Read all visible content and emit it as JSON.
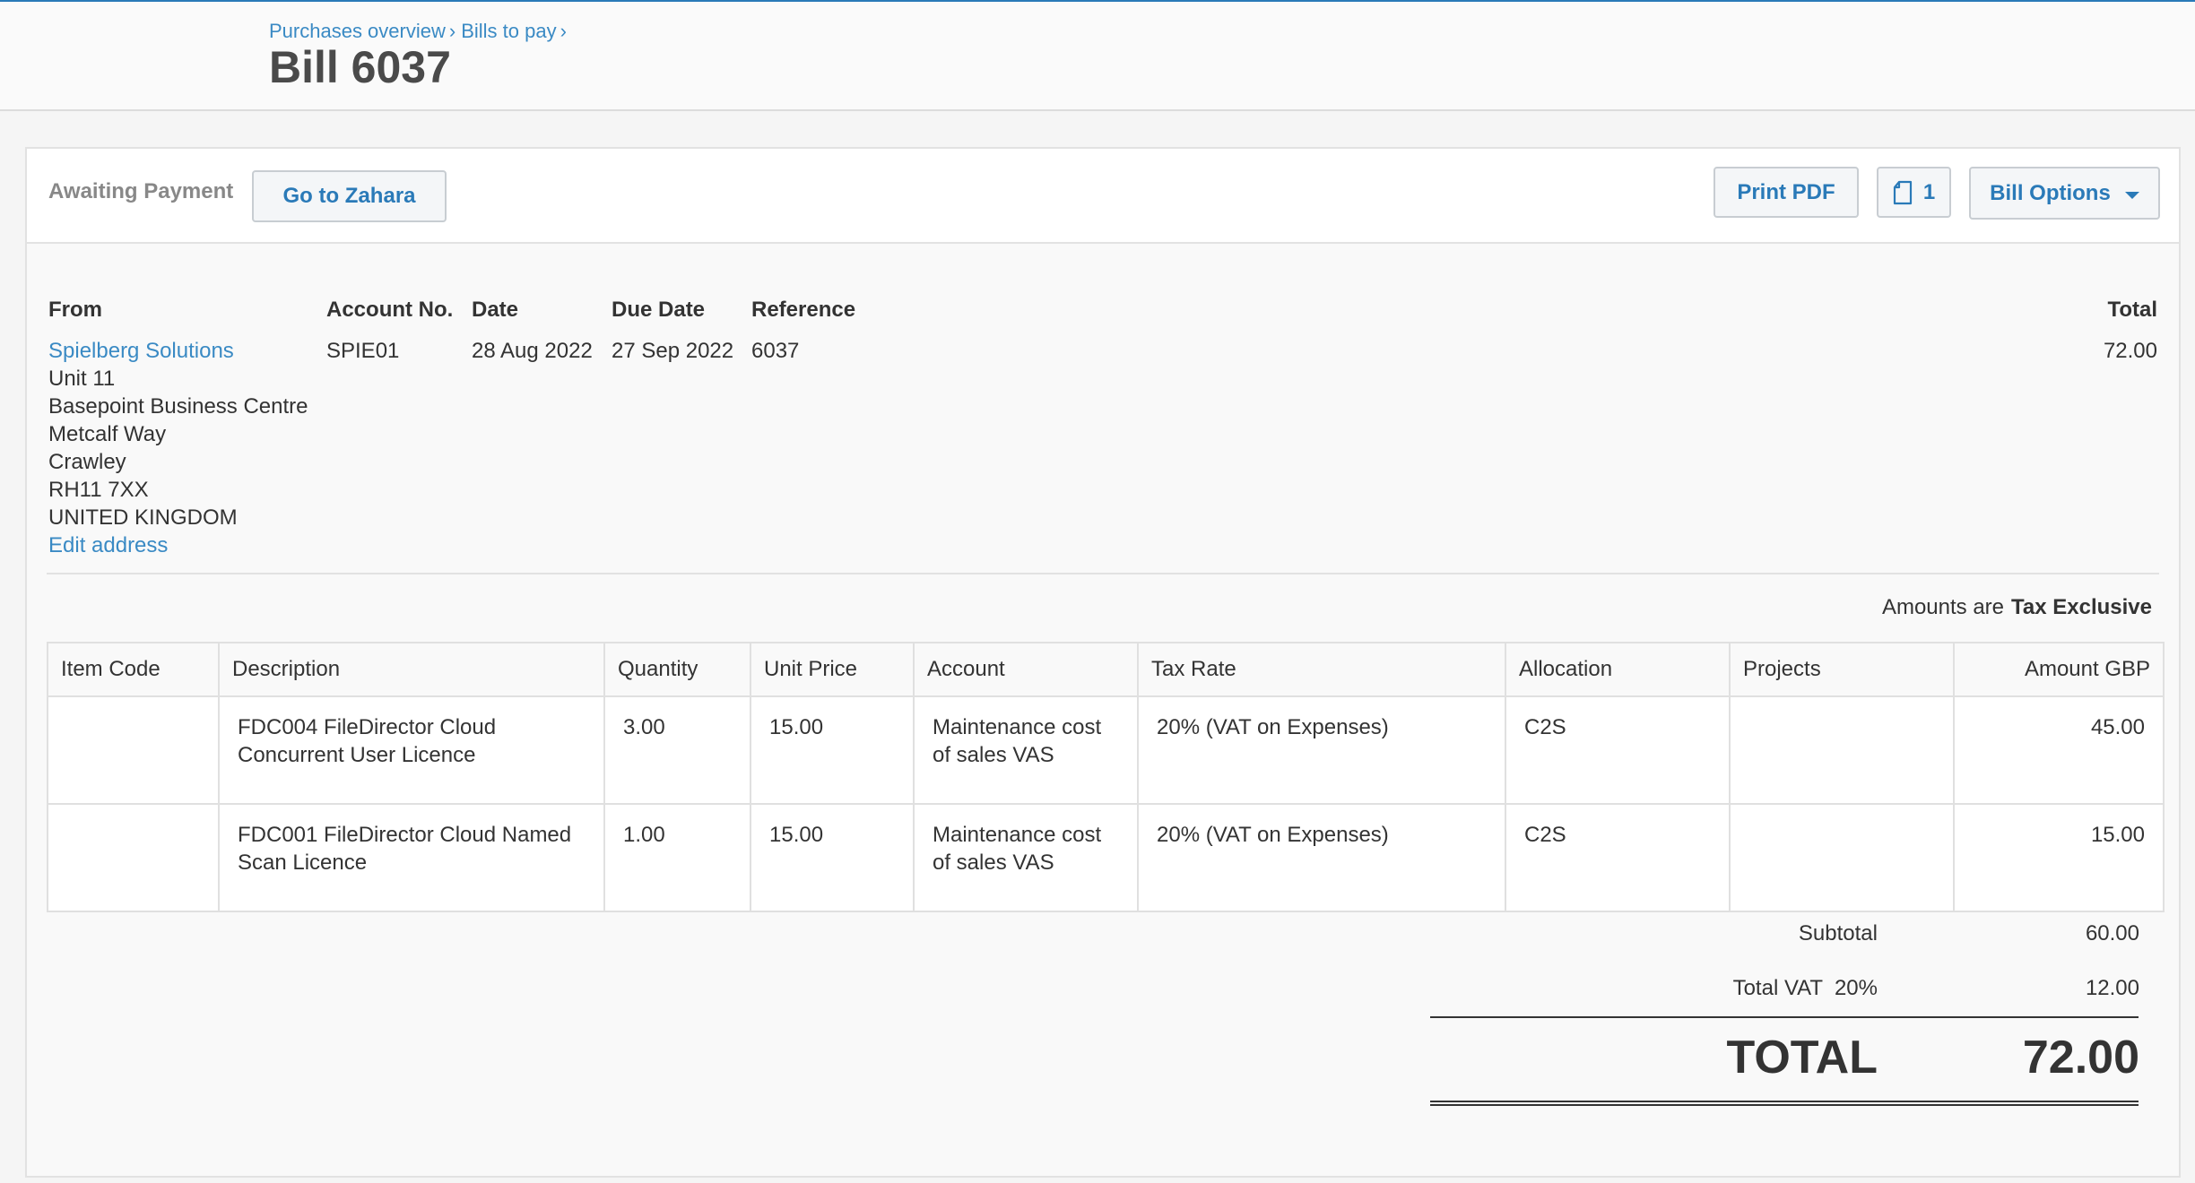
{
  "breadcrumb": [
    "Purchases overview",
    "Bills to pay"
  ],
  "page_title": "Bill 6037",
  "toolbar": {
    "status": "Awaiting Payment",
    "goto_label": "Go to Zahara",
    "print_label": "Print PDF",
    "attachment_count": "1",
    "options_label": "Bill Options"
  },
  "bill": {
    "labels": {
      "from": "From",
      "account_no": "Account No.",
      "date": "Date",
      "due_date": "Due Date",
      "reference": "Reference",
      "total": "Total"
    },
    "from_name": "Spielberg Solutions",
    "address": [
      "Unit 11",
      "Basepoint Business Centre",
      "Metcalf Way",
      "Crawley",
      "RH11 7XX",
      "UNITED KINGDOM"
    ],
    "edit_address": "Edit address",
    "account_no": "SPIE01",
    "date": "28 Aug 2022",
    "due_date": "27 Sep 2022",
    "reference": "6037",
    "total": "72.00"
  },
  "amounts_are": {
    "label": "Amounts are",
    "value": "Tax Exclusive"
  },
  "table": {
    "columns": [
      "Item Code",
      "Description",
      "Quantity",
      "Unit Price",
      "Account",
      "Tax Rate",
      "Allocation",
      "Projects",
      "Amount GBP"
    ],
    "rows": [
      [
        "",
        "FDC004 FileDirector Cloud Concurrent User Licence",
        "3.00",
        "15.00",
        "Maintenance cost of sales VAS",
        "20% (VAT on Expenses)",
        "C2S",
        "",
        "45.00"
      ],
      [
        "",
        "FDC001 FileDirector Cloud Named Scan Licence",
        "1.00",
        "15.00",
        "Maintenance cost of sales VAS",
        "20% (VAT on Expenses)",
        "C2S",
        "",
        "15.00"
      ]
    ]
  },
  "totals": {
    "subtotal_label": "Subtotal",
    "subtotal": "60.00",
    "vat_label": "Total VAT  20%",
    "vat": "12.00",
    "total_label": "TOTAL",
    "total": "72.00"
  }
}
